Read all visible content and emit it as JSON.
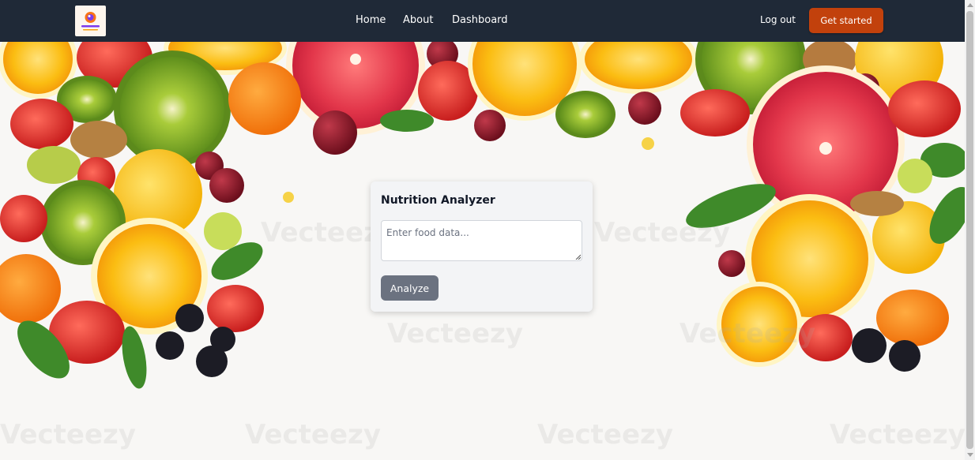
{
  "navbar": {
    "logo_alt": "AyurMe",
    "links": [
      {
        "label": "Home"
      },
      {
        "label": "About"
      },
      {
        "label": "Dashboard"
      }
    ],
    "logout_label": "Log out",
    "get_started_label": "Get started"
  },
  "analyzer": {
    "title": "Nutrition Analyzer",
    "input_placeholder": "Enter food data...",
    "input_value": "",
    "analyze_label": "Analyze"
  },
  "background": {
    "watermark_text": "Vecteezy"
  },
  "colors": {
    "navbar_bg": "#1f2937",
    "accent": "#c2410c",
    "analyze_button": "#6b7280",
    "card_bg": "#f3f4f6"
  },
  "icons": {
    "logo": "ayurme-logo-icon",
    "resize": "resize-grip-icon"
  }
}
